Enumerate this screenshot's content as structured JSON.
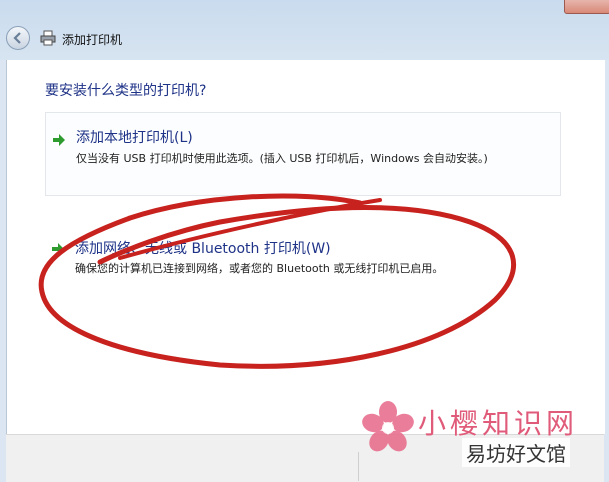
{
  "window": {
    "title": "添加打印机"
  },
  "page": {
    "question": "要安装什么类型的打印机?"
  },
  "options": [
    {
      "title": "添加本地打印机(L)",
      "description": "仅当没有 USB 打印机时使用此选项。(插入 USB 打印机后，Windows 会自动安装。)",
      "icon": "green-arrow-icon"
    },
    {
      "title": "添加网络、无线或 Bluetooth 打印机(W)",
      "description": "确保您的计算机已连接到网络，或者您的 Bluetooth 或无线打印机已启用。",
      "icon": "green-arrow-icon"
    }
  ],
  "watermark": {
    "line1": "小樱知识网",
    "line2": "易坊好文馆"
  },
  "colors": {
    "heading": "#1e3287",
    "annotation": "#c8221e",
    "watermark": "#e05a79",
    "arrow": "#2e9b2e"
  }
}
